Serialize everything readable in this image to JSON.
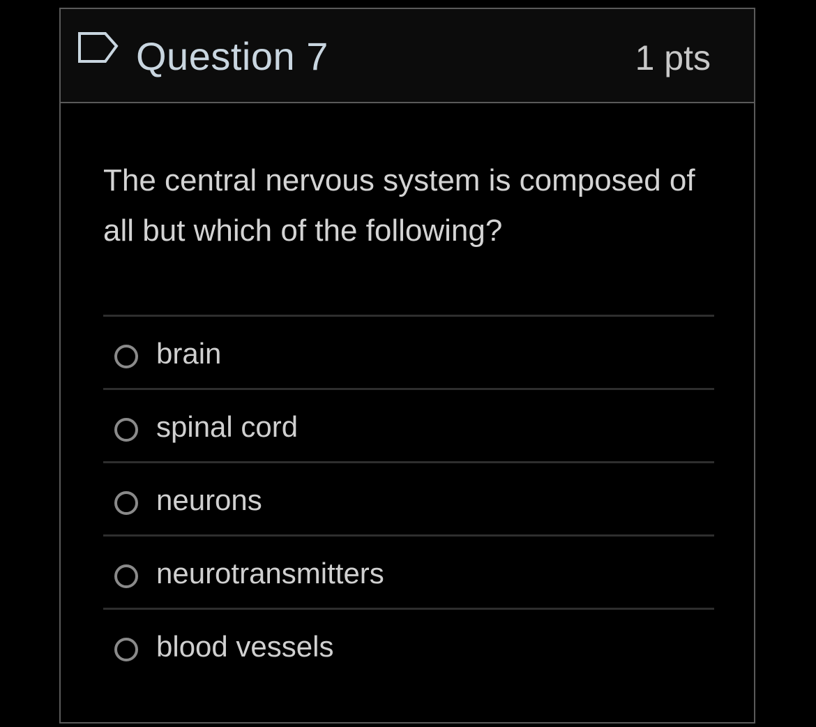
{
  "question": {
    "title": "Question 7",
    "points": "1 pts",
    "flag_icon": "flag-icon",
    "text": "The central nervous system is composed of all but which of the following?"
  },
  "answers": [
    {
      "label": "brain",
      "selected": false
    },
    {
      "label": "spinal cord",
      "selected": false
    },
    {
      "label": "neurons",
      "selected": false
    },
    {
      "label": "neurotransmitters",
      "selected": false
    },
    {
      "label": "blood vessels",
      "selected": false
    }
  ],
  "colors": {
    "background": "#000000",
    "header_background": "#0c0c0c",
    "border": "#5a5a5a",
    "title_text": "#c9d6e0",
    "body_text": "#d4d4d4",
    "radio_ring": "#8a8a8a"
  }
}
